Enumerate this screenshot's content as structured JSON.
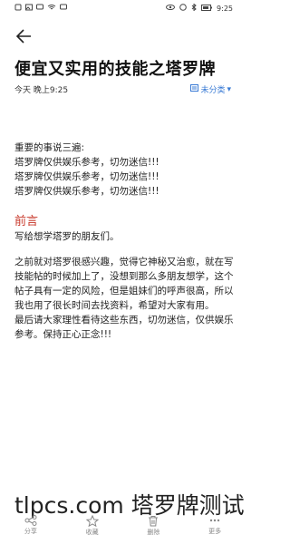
{
  "status_bar": {
    "left_icons": [
      "notification-icon",
      "image-icon",
      "message-icon",
      "wifi-icon",
      "message-icon"
    ],
    "time": "9:25"
  },
  "article": {
    "title": "便宜又实用的技能之塔罗牌",
    "date": "今天 晚上9:25",
    "category": "未分类",
    "intro": "重要的事说三遍:",
    "warnings": [
      "塔罗牌仅供娱乐参考，切勿迷信!!!",
      "塔罗牌仅供娱乐参考，切勿迷信!!!",
      "塔罗牌仅供娱乐参考，切勿迷信!!!"
    ],
    "section_title": "前言",
    "paragraphs": [
      "写给想学塔罗的朋友们。",
      "之前就对塔罗很感兴趣，觉得它神秘又治愈，就在写技能帖的时候加上了，没想到那么多朋友想学，这个帖子具有一定的风险，但是姐妹们的呼声很高，所以我也用了很长时间去找资料，希望对大家有用。",
      "最后请大家理性看待这些东西，切勿迷信，仅供娱乐参考。保持正心正念!!!"
    ]
  },
  "watermark": "tlpcs.com 塔罗牌测试",
  "toolbar": {
    "share": "分享",
    "favorite": "收藏",
    "delete": "删除",
    "more": "更多"
  },
  "colors": {
    "accent": "#3a7bd5",
    "heading": "#c8392b"
  }
}
